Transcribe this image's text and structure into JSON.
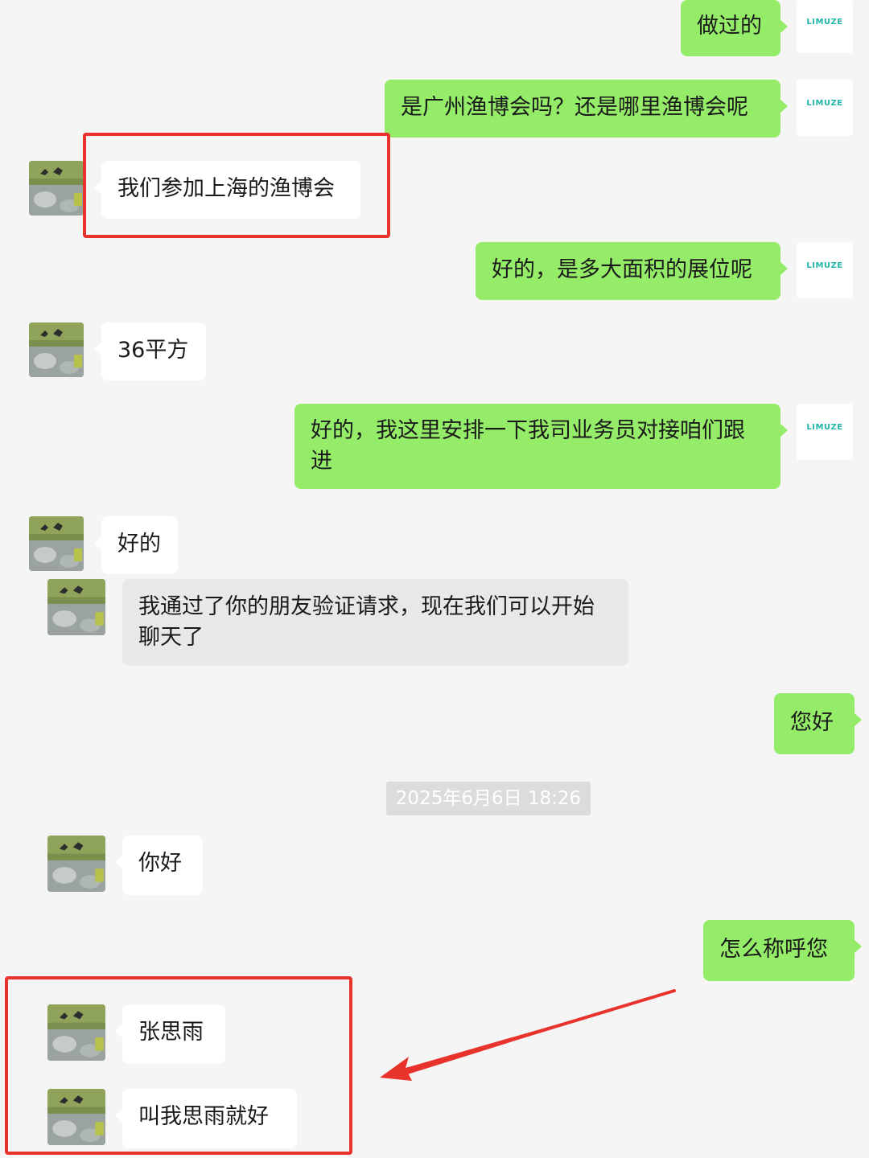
{
  "messages": {
    "m1": {
      "sender": "me",
      "text": "做过的"
    },
    "m2": {
      "sender": "me",
      "text": "是广州渔博会吗？还是哪里渔博会呢"
    },
    "m3": {
      "sender": "contact",
      "text": "我们参加上海的渔博会"
    },
    "m4": {
      "sender": "me",
      "text": "好的，是多大面积的展位呢"
    },
    "m5": {
      "sender": "contact",
      "text": "36平方"
    },
    "m6": {
      "sender": "me",
      "text": "好的，我这里安排一下我司业务员对接咱们跟进"
    },
    "m7": {
      "sender": "contact",
      "text": "好的"
    },
    "m8": {
      "sender": "contact",
      "text": "我通过了你的朋友验证请求，现在我们可以开始聊天了"
    },
    "m9": {
      "sender": "me",
      "text": "您好"
    },
    "m10": {
      "sender": "contact",
      "text": "你好"
    },
    "m11": {
      "sender": "me",
      "text": "怎么称呼您"
    },
    "m12": {
      "sender": "contact",
      "text": "张思雨"
    },
    "m13": {
      "sender": "contact",
      "text": "叫我思雨就好"
    }
  },
  "timestamp": "2025年6月6日 18:26",
  "my_avatar_logo_text": "LIMUZE",
  "colors": {
    "outgoing_bubble": "#95ec69",
    "incoming_bubble": "#ffffff",
    "system_bubble": "#e8e8e8",
    "background": "#f5f5f5",
    "highlight": "#e8332d"
  },
  "icons": {
    "my_avatar": "company-logo-icon",
    "contact_avatar": "bird-photo-icon"
  }
}
